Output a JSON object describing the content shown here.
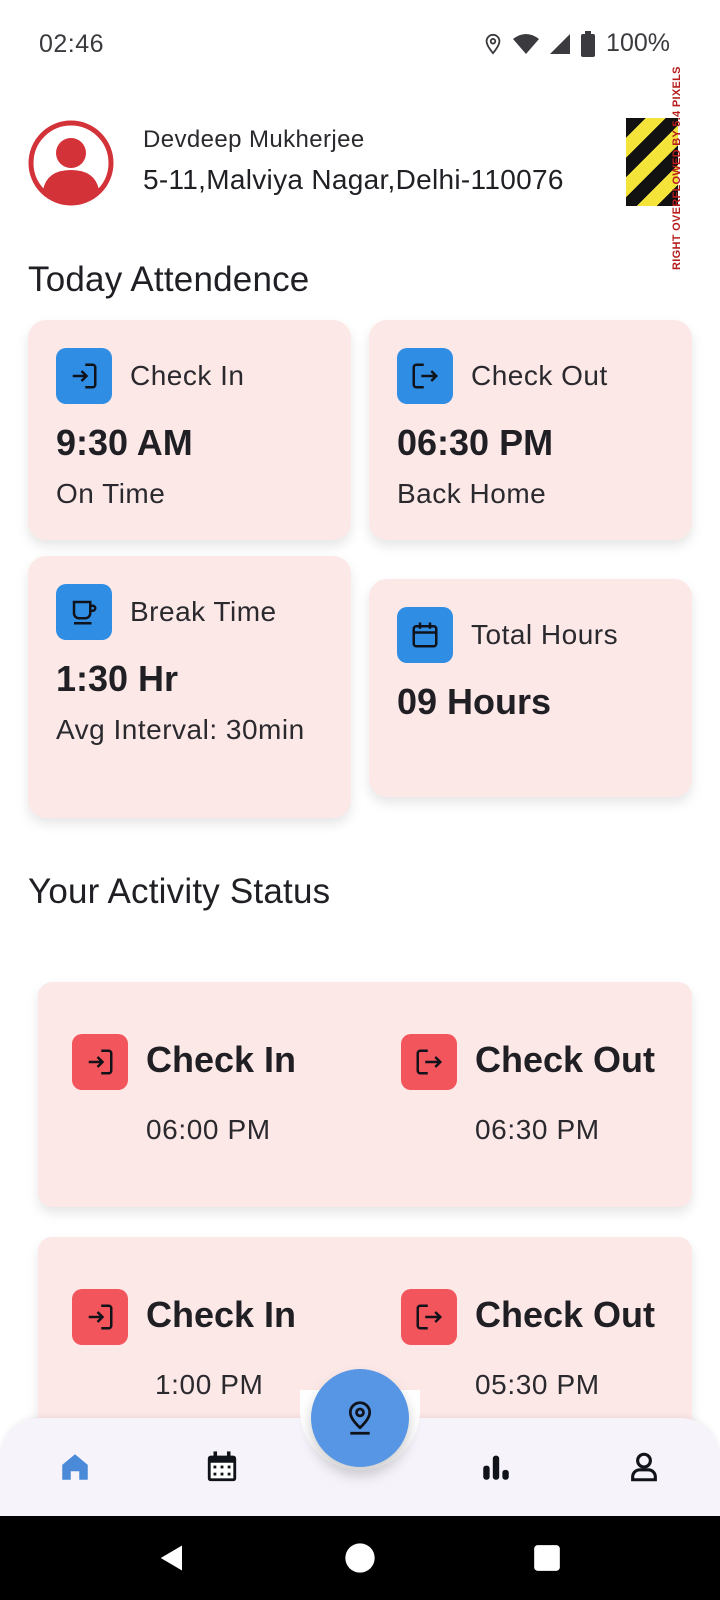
{
  "status_bar": {
    "time": "02:46",
    "battery": "100%",
    "icons": [
      "location-icon",
      "wifi-icon",
      "signal-icon",
      "battery-icon"
    ]
  },
  "header": {
    "name": "Devdeep Mukherjee",
    "address": "5-11,Malviya Nagar,Delhi-110076",
    "overflow_warning": "RIGHT OVERFLOWED BY 5.4 PIXELS"
  },
  "today": {
    "title": "Today Attendence",
    "cards": [
      {
        "icon": "login-icon",
        "label": "Check In",
        "value": "9:30 AM",
        "sub": "On Time"
      },
      {
        "icon": "logout-icon",
        "label": "Check Out",
        "value": "06:30 PM",
        "sub": "Back Home"
      },
      {
        "icon": "coffee-icon",
        "label": "Break Time",
        "value": "1:30 Hr",
        "sub": "Avg Interval: 30min"
      },
      {
        "icon": "calendar-icon",
        "label": "Total Hours",
        "value": "09 Hours",
        "sub": ""
      }
    ]
  },
  "activity": {
    "title": "Your Activity Status",
    "items": [
      {
        "check_in_label": "Check In",
        "check_in_time": "06:00 PM",
        "check_out_label": "Check Out",
        "check_out_time": "06:30 PM"
      },
      {
        "check_in_label": "Check In",
        "check_in_time": "1:00 PM",
        "check_out_label": "Check Out",
        "check_out_time": "05:30 PM"
      }
    ]
  },
  "bottom_nav": {
    "items": [
      "home-icon",
      "calendar-icon",
      "location-pin-icon",
      "bar-chart-icon",
      "profile-icon"
    ],
    "active": "home-icon"
  },
  "colors": {
    "card_bg": "#fde8e8",
    "attendance_icon_bg": "#2f8de4",
    "activity_icon_bg": "#f2555b",
    "fab": "#5696e4",
    "nav_active": "#4b8ad8"
  }
}
